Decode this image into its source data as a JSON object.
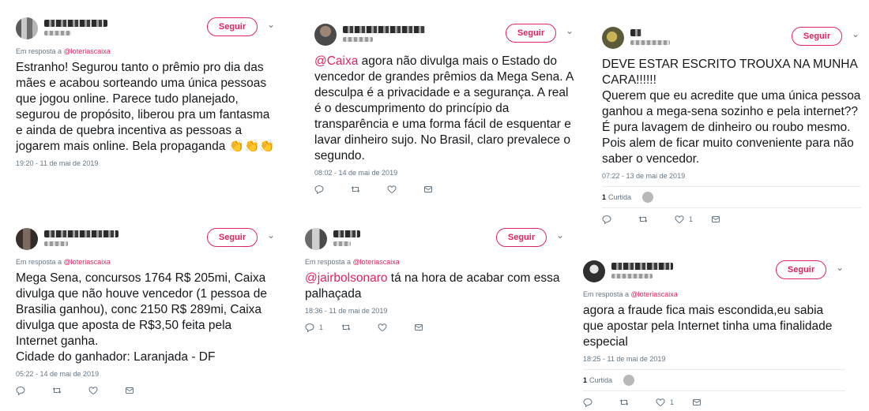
{
  "follow_label": "Seguir",
  "reply_prefix": "Em resposta a",
  "tweets": [
    {
      "reply_to": "@loteriascaixa",
      "text": "Estranho! Segurou tanto o prêmio pro dia das mães e acabou sorteando uma única pessoas que jogou online. Parece tudo planejado, segurou de propósito, liberou pra um fantasma  e ainda de quebra incentiva as pessoas a jogarem mais online. Bela propaganda",
      "emoji": "👏👏👏",
      "time": "19:20 - 11 de mai de 2019"
    },
    {
      "mention": "@Caixa",
      "text": " agora não divulga mais o Estado do vencedor de grandes prêmios da Mega Sena. A desculpa é a privacidade e a segurança. A real é o descumprimento do princípio da transparência e uma forma fácil de esquentar e lavar dinheiro sujo. No Brasil, claro prevalece o segundo.",
      "time": "08:02 - 14 de mai de 2019",
      "actions": {
        "reply": "",
        "retweet": "",
        "like": "",
        "dm": ""
      }
    },
    {
      "text": "DEVE ESTAR ESCRITO TROUXA NA MUNHA CARA!!!!!!\nQuerem que eu acredite que uma única pessoa ganhou a mega-sena sozinho e pela internet??\nÉ pura lavagem de dinheiro ou roubo mesmo. Pois alem de ficar muito conveniente para não saber o vencedor.",
      "time": "07:22 - 13 de mai de 2019",
      "likes_count": "1",
      "likes_label": "Curtida",
      "actions": {
        "reply": "",
        "retweet": "",
        "like": "1",
        "dm": ""
      }
    },
    {
      "reply_to": "@loteriascaixa",
      "text": "Mega Sena, concursos 1764 R$ 205mi, Caixa divulga que não houve vencedor (1 pessoa de Brasilia ganhou), conc 2150 R$ 289mi, Caixa divulga que aposta de R$3,50 feita pela Internet ganha.\nCidade do ganhador: Laranjada - DF",
      "time": "05:22 - 14 de mai de 2019",
      "actions": {
        "reply": "",
        "retweet": "",
        "like": "",
        "dm": ""
      }
    },
    {
      "reply_to": "@loteriascaixa",
      "mention": "@jairbolsonaro",
      "text": "  tá na hora de acabar com essa palhaçada",
      "time": "18:36 - 11 de mai de 2019",
      "actions": {
        "reply": "1",
        "retweet": "",
        "like": "",
        "dm": ""
      }
    },
    {
      "reply_to": "@loteriascaixa",
      "text": "agora a fraude fica mais escondida,eu sabia que apostar pela Internet tinha uma finalidade especial",
      "time": "18:25 - 11 de mai de 2019",
      "likes_count": "1",
      "likes_label": "Curtida",
      "actions": {
        "reply": "",
        "retweet": "",
        "like": "1",
        "dm": ""
      }
    }
  ]
}
